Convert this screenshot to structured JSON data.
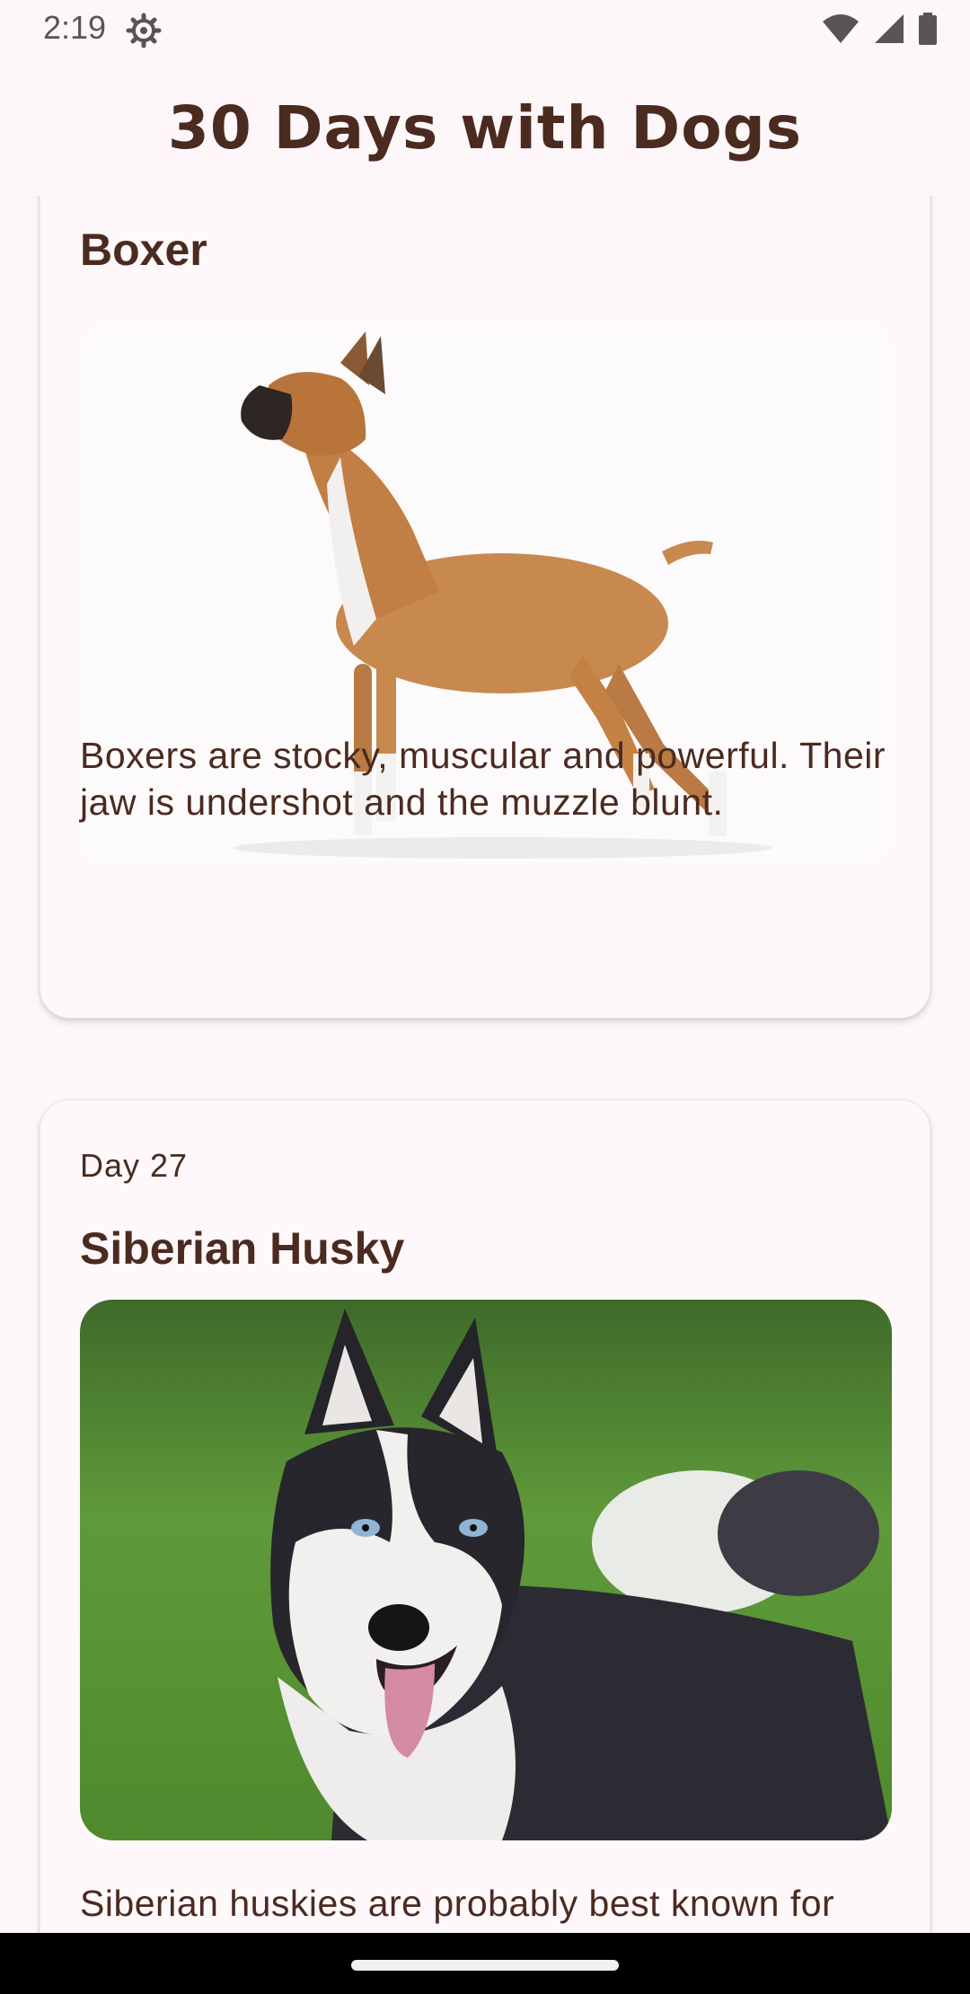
{
  "status_bar": {
    "time": "2:19",
    "icons": [
      "settings-icon",
      "wifi-icon",
      "cell-signal-icon",
      "battery-icon"
    ]
  },
  "app_bar": {
    "title": "30 Days with Dogs"
  },
  "dogs": [
    {
      "day": "",
      "name": "Boxer",
      "description": "Boxers are stocky, muscular and powerful. Their jaw is undershot and the muzzle blunt.",
      "photo": "boxer-photo"
    },
    {
      "day": "Day 27",
      "name": "Siberian Husky",
      "description": "Siberian huskies are probably best known for their incredible",
      "photo": "husky-photo"
    }
  ],
  "colors": {
    "background": "#fdf7fa",
    "text": "#4b2a1f",
    "card": "#fef8fb"
  }
}
